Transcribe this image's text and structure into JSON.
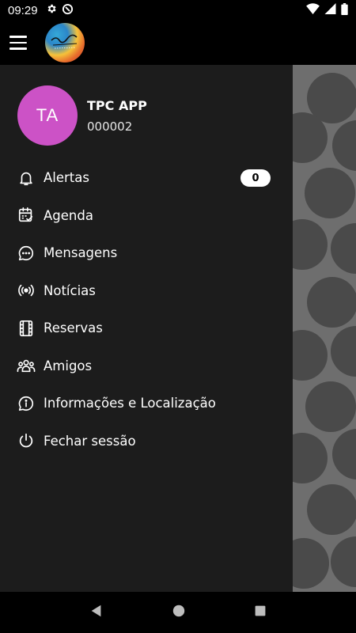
{
  "status_bar": {
    "time": "09:29",
    "icons": [
      "settings-icon",
      "data-saver-icon",
      "wifi-icon",
      "signal-icon",
      "battery-icon"
    ]
  },
  "app_bar": {
    "menu_icon": "hamburger-menu-icon",
    "logo": "arena-logo"
  },
  "profile": {
    "initials": "TA",
    "name": "TPC APP",
    "id": "000002",
    "avatar_color": "#cc52c6"
  },
  "menu": {
    "items": [
      {
        "label": "Alertas",
        "icon": "bell-icon",
        "badge": "0"
      },
      {
        "label": "Agenda",
        "icon": "calendar-check-icon"
      },
      {
        "label": "Mensagens",
        "icon": "chat-bubble-icon"
      },
      {
        "label": "Notícias",
        "icon": "broadcast-icon"
      },
      {
        "label": "Reservas",
        "icon": "film-strip-icon"
      },
      {
        "label": "Amigos",
        "icon": "group-icon"
      },
      {
        "label": "Informações e Localização",
        "icon": "info-bubble-icon"
      },
      {
        "label": "Fechar sessão",
        "icon": "power-icon"
      }
    ]
  },
  "nav_bar": {
    "buttons": [
      "back-icon",
      "home-icon",
      "recents-icon"
    ]
  },
  "colors": {
    "drawer_bg": "#1c1c1c",
    "scrim": "#6e6e6e",
    "avatar": "#cc52c6"
  }
}
